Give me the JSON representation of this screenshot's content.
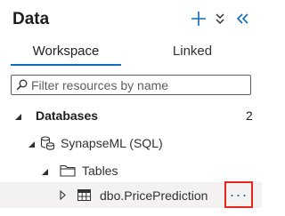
{
  "header": {
    "title": "Data",
    "add_icon": "plus-icon",
    "collapse_all_icon": "double-chevron-down-icon",
    "hide_panel_icon": "double-chevron-left-icon"
  },
  "tabs": [
    {
      "label": "Workspace",
      "selected": true
    },
    {
      "label": "Linked",
      "selected": false
    }
  ],
  "filter": {
    "placeholder": "Filter resources by name",
    "value": ""
  },
  "tree": {
    "databases": {
      "label": "Databases",
      "count": "2",
      "expanded": true
    },
    "database": {
      "label": "SynapseML (SQL)",
      "expanded": true
    },
    "tables": {
      "label": "Tables",
      "expanded": true
    },
    "table": {
      "label": "dbo.PricePrediction",
      "expanded": false,
      "more_label": "···"
    }
  },
  "colors": {
    "accent": "#0f6cbd",
    "highlight_border": "#e8261c",
    "selected_row": "#f3f2f1"
  }
}
